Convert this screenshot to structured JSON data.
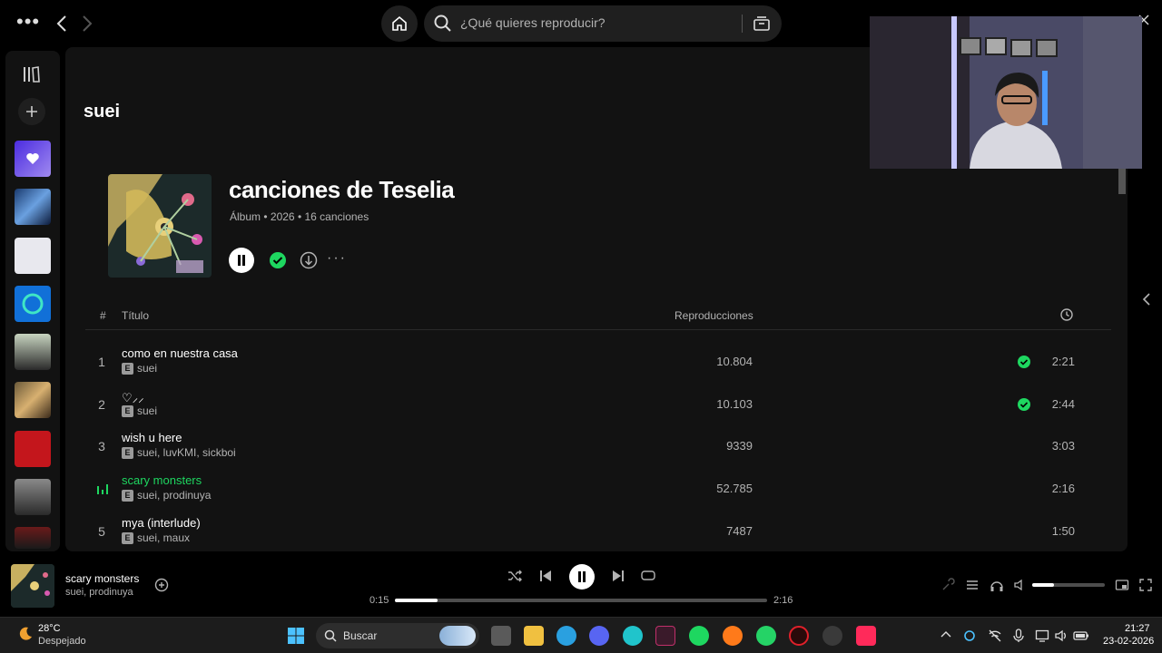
{
  "topbar": {
    "search_placeholder": "¿Qué quieres reproducir?"
  },
  "artist": {
    "name": "suei"
  },
  "album": {
    "title": "canciones de Teselia",
    "type": "Álbum",
    "year": "2026",
    "song_count": "16 canciones"
  },
  "table": {
    "col_num": "#",
    "col_title": "Título",
    "col_plays": "Reproducciones"
  },
  "tracks": [
    {
      "num": "1",
      "title": "como en nuestra casa",
      "artists": "suei",
      "plays": "10.804",
      "saved": true,
      "duration": "2:21",
      "playing": false
    },
    {
      "num": "2",
      "title": "♡⸝⸝",
      "artists": "suei",
      "plays": "10.103",
      "saved": true,
      "duration": "2:44",
      "playing": false
    },
    {
      "num": "3",
      "title": "wish u here",
      "artists": "suei, luvKMI, sickboi",
      "plays": "9339",
      "saved": false,
      "duration": "3:03",
      "playing": false
    },
    {
      "num": "4",
      "title": "scary monsters",
      "artists": "suei, prodinuya",
      "plays": "52.785",
      "saved": false,
      "duration": "2:16",
      "playing": true
    },
    {
      "num": "5",
      "title": "mya (interlude)",
      "artists": "suei, maux",
      "plays": "7487",
      "saved": false,
      "duration": "1:50",
      "playing": false
    }
  ],
  "explicit_badge": "E",
  "player": {
    "title": "scary monsters",
    "artists": "suei, prodinuya",
    "current_time": "0:15",
    "total_time": "2:16",
    "progress_fraction": 0.115,
    "volume_fraction": 0.3
  },
  "taskbar": {
    "temperature": "28°C",
    "condition": "Despejado",
    "search_placeholder": "Buscar",
    "time": "21:27",
    "date": "23-02-2026"
  },
  "colors": {
    "accent": "#1ed760",
    "background": "#121212",
    "text_secondary": "#b3b3b3"
  }
}
